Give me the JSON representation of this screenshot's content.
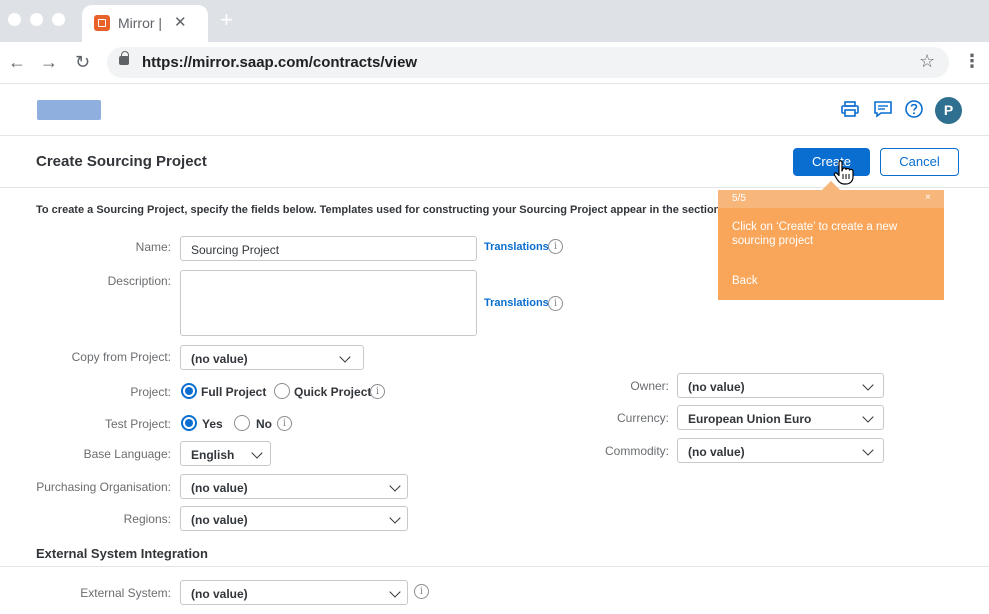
{
  "browser": {
    "tab_title": "Mirror |",
    "tab_close": "✕",
    "new_tab": "+",
    "url": "https://mirror.saap.com/contracts/view"
  },
  "header": {
    "avatar_initial": "P",
    "icons": [
      "print-icon",
      "feedback-icon",
      "help-icon"
    ]
  },
  "page": {
    "title": "Create Sourcing Project",
    "create_label": "Create",
    "cancel_label": "Cancel",
    "intro": "To create a Sourcing Project, specify the fields below. Templates used for constructing your Sourcing Project appear in the section"
  },
  "form": {
    "name_label": "Name:",
    "name_value": "Sourcing Project",
    "description_label": "Description:",
    "description_value": "",
    "translations": "Translations",
    "copy_label": "Copy from Project:",
    "copy_value": "(no value)",
    "project_label": "Project:",
    "project_opt1": "Full Project",
    "project_opt2": "Quick Project",
    "test_label": "Test Project:",
    "test_yes": "Yes",
    "test_no": "No",
    "language_label": "Base Language:",
    "language_value": "English",
    "purch_label": "Purchasing Organisation:",
    "purch_value": "(no value)",
    "regions_label": "Regions:",
    "regions_value": "(no value)",
    "owner_label": "Owner:",
    "owner_value": "(no value)",
    "currency_label": "Currency:",
    "currency_value": "European Union Euro",
    "commodity_label": "Commodity:",
    "commodity_value": "(no value)",
    "info_glyph": "i"
  },
  "external": {
    "section_title": "External System Integration",
    "system_label": "External System:",
    "system_value": "(no value)"
  },
  "coachmark": {
    "step": "5/5",
    "close": "×",
    "message": "Click on ‘Create’ to create a new sourcing project",
    "back": "Back",
    "color": "#f9a65a"
  },
  "colors": {
    "accent": "#0a6ed1"
  }
}
